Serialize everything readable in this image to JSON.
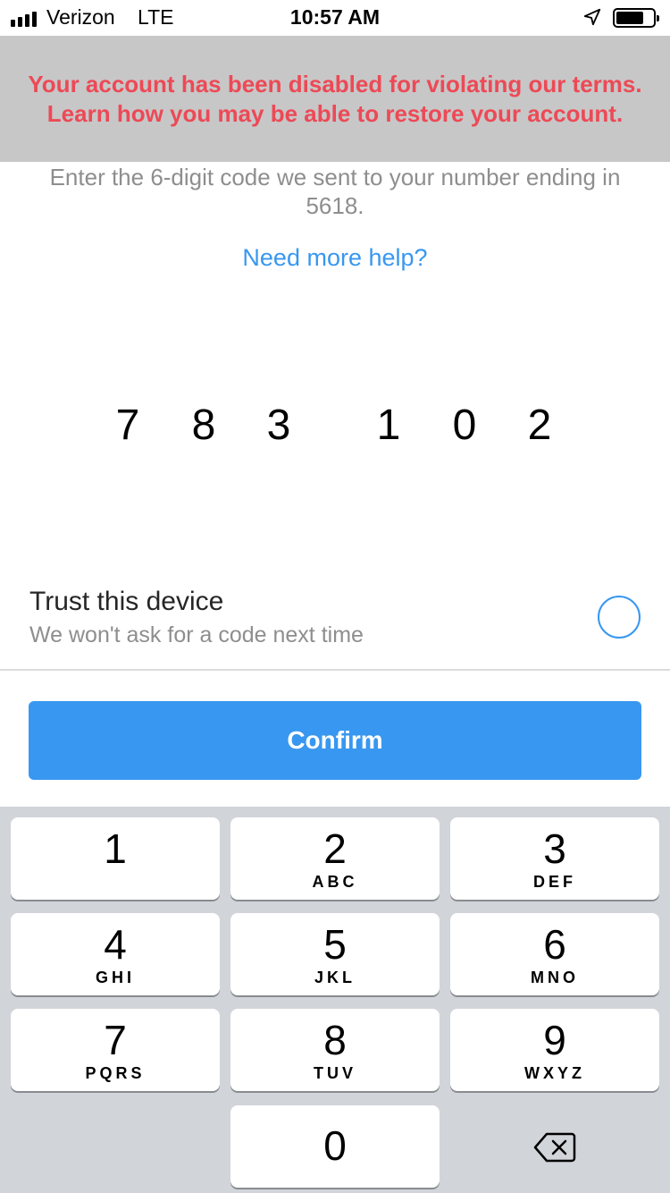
{
  "status_bar": {
    "carrier": "Verizon",
    "network": "LTE",
    "time": "10:57 AM",
    "signal_bars": 4,
    "battery_level": 0.75,
    "icons": [
      "signal-icon",
      "location-arrow-icon",
      "battery-icon"
    ]
  },
  "banner": {
    "message": "Your account has been disabled for violating our terms. Learn how you may be able to restore your account.",
    "color": "#ed4956",
    "background": "#c7c7c7"
  },
  "instructions": {
    "text": "Enter the 6-digit code we sent to your number ending in 5618."
  },
  "help": {
    "link_label": "Need more help?"
  },
  "code": {
    "digits": [
      "7",
      "8",
      "3",
      "1",
      "0",
      "2"
    ]
  },
  "trust_device": {
    "title": "Trust this device",
    "subtitle": "We won't ask for a code next time",
    "checked": false
  },
  "confirm": {
    "label": "Confirm",
    "color": "#3897f0"
  },
  "keypad": {
    "keys": [
      {
        "num": "1",
        "letters": ""
      },
      {
        "num": "2",
        "letters": "ABC"
      },
      {
        "num": "3",
        "letters": "DEF"
      },
      {
        "num": "4",
        "letters": "GHI"
      },
      {
        "num": "5",
        "letters": "JKL"
      },
      {
        "num": "6",
        "letters": "MNO"
      },
      {
        "num": "7",
        "letters": "PQRS"
      },
      {
        "num": "8",
        "letters": "TUV"
      },
      {
        "num": "9",
        "letters": "WXYZ"
      },
      {
        "num": "0",
        "letters": ""
      }
    ],
    "backspace_icon": "backspace-icon"
  }
}
